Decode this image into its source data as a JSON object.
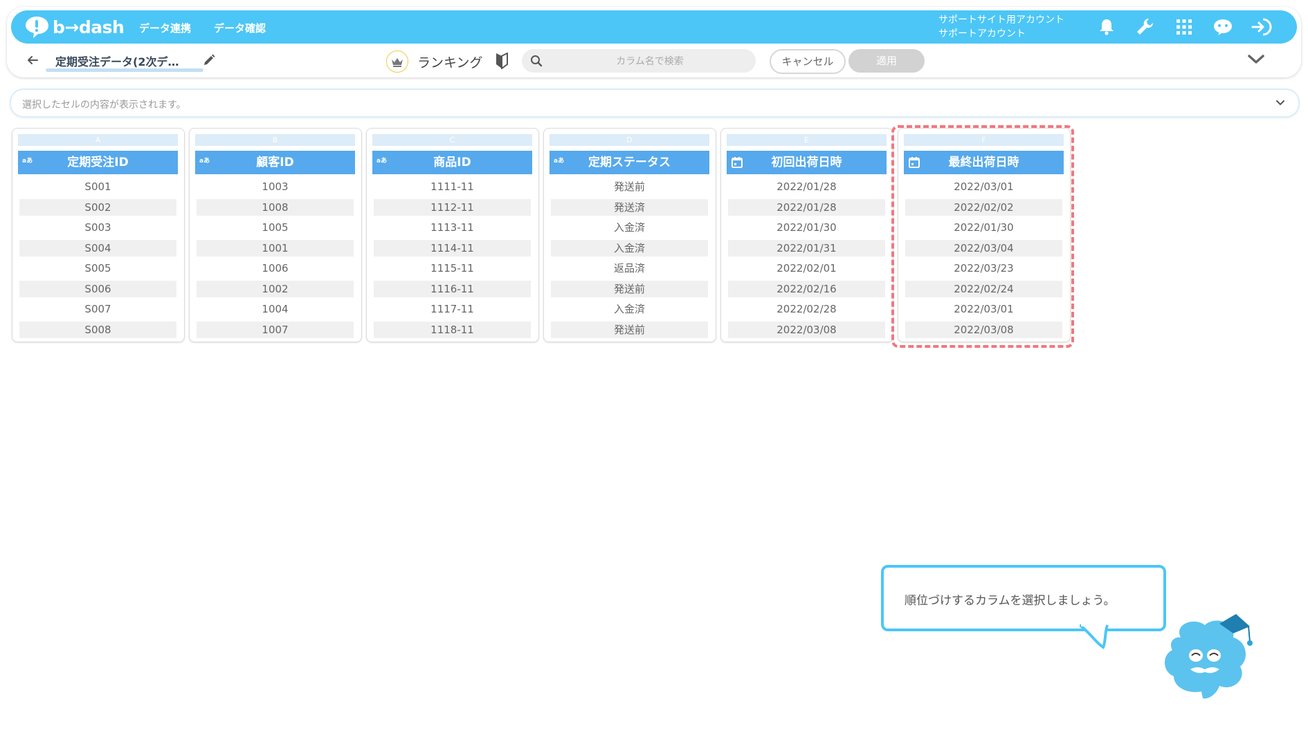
{
  "app": {
    "logo_text": "b→dash",
    "nav": [
      "データ連携",
      "データ確認"
    ],
    "account": {
      "line1": "サポートサイト用アカウント",
      "line2": "サポートアカウント"
    },
    "icons": [
      "bell-icon",
      "wrench-icon",
      "grid-icon",
      "chat-bot-icon",
      "logout-icon"
    ]
  },
  "toolbar": {
    "dataset_name": "定期受注データ(2次デ…",
    "ranking_label": "ランキング",
    "search_placeholder": "カラム名で検索",
    "cancel_label": "キャンセル",
    "apply_label": "適用"
  },
  "cell_bar": {
    "placeholder": "選択したセルの内容が表示されます。"
  },
  "colors": {
    "brand": "#4cc6f6",
    "header": "#56a9ec",
    "highlight": "#f07880"
  },
  "columns": [
    {
      "letter": "A",
      "name": "定期受注ID",
      "type_badge": "aあ",
      "type": "text",
      "values": [
        "S001",
        "S002",
        "S003",
        "S004",
        "S005",
        "S006",
        "S007",
        "S008"
      ]
    },
    {
      "letter": "B",
      "name": "顧客ID",
      "type_badge": "aあ",
      "type": "text",
      "values": [
        "1003",
        "1008",
        "1005",
        "1001",
        "1006",
        "1002",
        "1004",
        "1007"
      ]
    },
    {
      "letter": "C",
      "name": "商品ID",
      "type_badge": "aあ",
      "type": "text",
      "values": [
        "1111-11",
        "1112-11",
        "1113-11",
        "1114-11",
        "1115-11",
        "1116-11",
        "1117-11",
        "1118-11"
      ]
    },
    {
      "letter": "D",
      "name": "定期ステータス",
      "type_badge": "aあ",
      "type": "text",
      "values": [
        "発送前",
        "発送済",
        "入金済",
        "入金済",
        "返品済",
        "発送前",
        "入金済",
        "発送前"
      ]
    },
    {
      "letter": "E",
      "name": "初回出荷日時",
      "type_badge": "",
      "type": "date",
      "values": [
        "2022/01/28",
        "2022/01/28",
        "2022/01/30",
        "2022/01/31",
        "2022/02/01",
        "2022/02/16",
        "2022/02/28",
        "2022/03/08"
      ]
    },
    {
      "letter": "F",
      "name": "最終出荷日時",
      "type_badge": "",
      "type": "date",
      "values": [
        "2022/03/01",
        "2022/02/02",
        "2022/01/30",
        "2022/03/04",
        "2022/03/23",
        "2022/02/24",
        "2022/03/01",
        "2022/03/08"
      ]
    }
  ],
  "tooltip": {
    "text": "順位づけするカラムを選択しましょう。"
  }
}
